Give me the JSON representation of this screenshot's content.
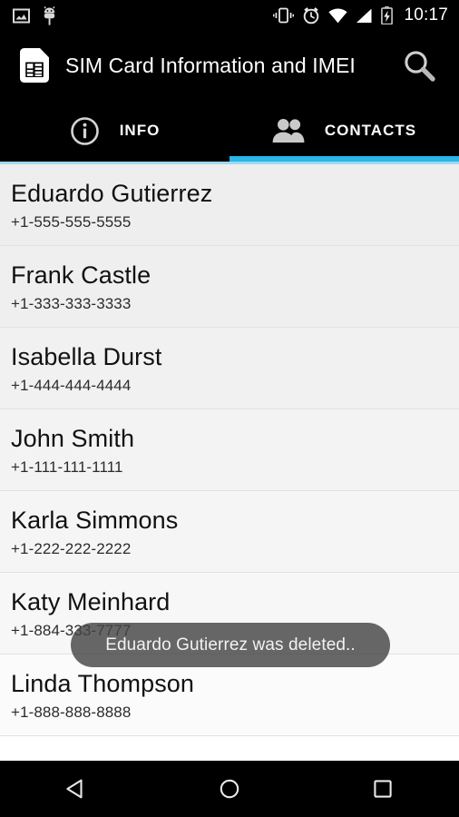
{
  "statusbar": {
    "time": "10:17",
    "left_icons": [
      "image-icon",
      "android-debug-icon"
    ],
    "right_icons": [
      "vibrate-icon",
      "alarm-icon",
      "wifi-icon",
      "cell-signal-icon",
      "battery-charging-icon"
    ]
  },
  "actionbar": {
    "app_icon": "sim-card-icon",
    "title": "SIM Card Information and IMEI",
    "search_icon": "search-icon"
  },
  "tabs": [
    {
      "label": "INFO",
      "icon": "info-circle-icon",
      "selected": false
    },
    {
      "label": "CONTACTS",
      "icon": "people-icon",
      "selected": true
    }
  ],
  "theme": {
    "accent": "#29b6e8",
    "accent_light": "#9fd9f0",
    "bar_background": "#000000",
    "list_background": "#f2f2f2",
    "toast_background": "#464646"
  },
  "contacts": [
    {
      "name": "Eduardo Gutierrez",
      "phone": "+1-555-555-5555"
    },
    {
      "name": "Frank Castle",
      "phone": "+1-333-333-3333"
    },
    {
      "name": "Isabella Durst",
      "phone": "+1-444-444-4444"
    },
    {
      "name": "John Smith",
      "phone": "+1-111-111-1111"
    },
    {
      "name": "Karla Simmons",
      "phone": "+1-222-222-2222"
    },
    {
      "name": "Katy Meinhard",
      "phone": "+1-884-333-7777"
    },
    {
      "name": "Linda Thompson",
      "phone": "+1-888-888-8888"
    }
  ],
  "toast": {
    "message": "Eduardo Gutierrez was deleted.."
  },
  "navbar": {
    "back": "back-triangle-icon",
    "home": "home-circle-icon",
    "recents": "recents-square-icon"
  }
}
